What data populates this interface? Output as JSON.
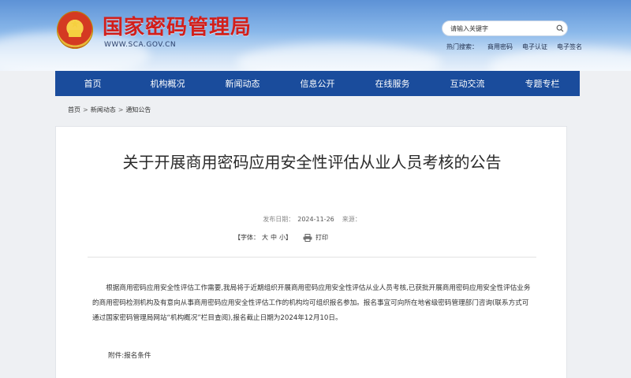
{
  "header": {
    "site_title": "国家密码管理局",
    "site_url": "WWW.SCA.GOV.CN",
    "search_placeholder": "请输入关键字",
    "hot_label": "热门搜索：",
    "hot_links": [
      "商用密码",
      "电子认证",
      "电子签名"
    ]
  },
  "nav": {
    "items": [
      "首页",
      "机构概况",
      "新闻动态",
      "信息公开",
      "在线服务",
      "互动交流",
      "专题专栏"
    ]
  },
  "breadcrumb": {
    "items": [
      "首页",
      "新闻动态",
      "通知公告"
    ],
    "separator": ">"
  },
  "article": {
    "title": "关于开展商用密码应用安全性评估从业人员考核的公告",
    "date_label": "发布日期：",
    "date": "2024-11-26",
    "source_label": "来源：",
    "font_label": "【字体：",
    "font_large": "大",
    "font_medium": "中",
    "font_small": "小】",
    "print_label": "打印",
    "body": "根据商用密码应用安全性评估工作需要,我局将于近期组织开展商用密码应用安全性评估从业人员考核,已获批开展商用密码应用安全性评估业务的商用密码检测机构及有意向从事商用密码应用安全性评估工作的机构均可组织报名参加。报名事宜可向所在地省级密码管理部门咨询(联系方式可通过国家密码管理局网站“机构概况”栏目查阅),报名截止日期为2024年12月10日。",
    "attachment": "附件:报名条件"
  },
  "colors": {
    "nav_bg": "#1a4c9c",
    "title_red": "#d21f1b"
  }
}
